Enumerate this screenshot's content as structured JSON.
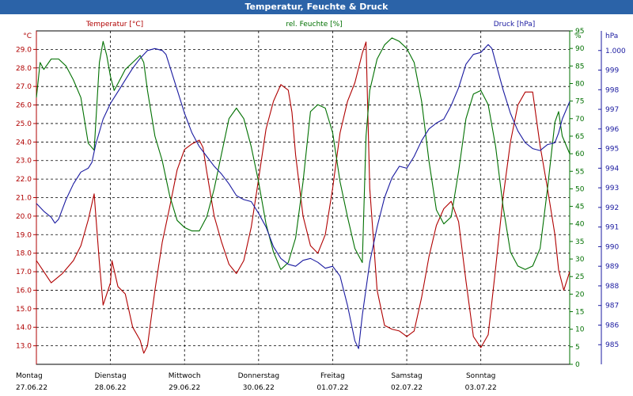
{
  "window": {
    "title": "Temperatur, Feuchte & Druck"
  },
  "chart_data": {
    "type": "line",
    "title": "Temperatur, Feuchte & Druck",
    "grid": true,
    "x_days": [
      {
        "day": "Montag",
        "date": "27.06.22"
      },
      {
        "day": "Dienstag",
        "date": "28.06.22"
      },
      {
        "day": "Mittwoch",
        "date": "29.06.22"
      },
      {
        "day": "Donnerstag",
        "date": "30.06.22"
      },
      {
        "day": "Freitag",
        "date": "01.07.22"
      },
      {
        "day": "Samstag",
        "date": "02.07.22"
      },
      {
        "day": "Sonntag",
        "date": "03.07.22"
      }
    ],
    "x_range_days": [
      0,
      7.2
    ],
    "axes": {
      "temperature": {
        "label": "Temperatur [°C]",
        "unit": "°C",
        "color": "#b00000",
        "min": 12.0,
        "max": 30.0,
        "ticks": [
          "29.0",
          "28.0",
          "27.0",
          "26.0",
          "25.0",
          "24.0",
          "23.0",
          "22.0",
          "21.0",
          "20.0",
          "19.0",
          "18.0",
          "17.0",
          "16.0",
          "15.0",
          "14.0",
          "13.0"
        ]
      },
      "humidity": {
        "label": "rel. Feuchte [%]",
        "unit": "%",
        "color": "#007000",
        "min": 0,
        "max": 95,
        "ticks": [
          "95",
          "90",
          "85",
          "80",
          "75",
          "70",
          "65",
          "60",
          "55",
          "50",
          "45",
          "40",
          "35",
          "30",
          "25",
          "20",
          "15",
          "10",
          "5",
          "0"
        ]
      },
      "pressure": {
        "label": "Druck [hPa]",
        "unit": "hPa",
        "color": "#1a1aa0",
        "min": 984.0,
        "max": 1001.0,
        "ticks": [
          "1.000",
          "999",
          "998",
          "997",
          "996",
          "995",
          "994",
          "993",
          "992",
          "991",
          "990",
          "989",
          "988",
          "987",
          "986",
          "985"
        ]
      }
    },
    "series": [
      {
        "name": "Temperatur [°C]",
        "axis": "temperature",
        "color": "#b00000",
        "points": [
          [
            0,
            17.6
          ],
          [
            0.1,
            17.0
          ],
          [
            0.2,
            16.4
          ],
          [
            0.35,
            16.9
          ],
          [
            0.5,
            17.6
          ],
          [
            0.6,
            18.4
          ],
          [
            0.7,
            19.8
          ],
          [
            0.78,
            21.2
          ],
          [
            0.85,
            17.5
          ],
          [
            0.9,
            15.2
          ],
          [
            1.0,
            16.4
          ],
          [
            1.02,
            17.6
          ],
          [
            1.1,
            16.2
          ],
          [
            1.2,
            15.8
          ],
          [
            1.3,
            14.0
          ],
          [
            1.4,
            13.3
          ],
          [
            1.45,
            12.6
          ],
          [
            1.5,
            13.0
          ],
          [
            1.6,
            16.0
          ],
          [
            1.7,
            18.6
          ],
          [
            1.8,
            20.5
          ],
          [
            1.9,
            22.5
          ],
          [
            2.0,
            23.6
          ],
          [
            2.1,
            23.9
          ],
          [
            2.2,
            24.1
          ],
          [
            2.25,
            23.7
          ],
          [
            2.3,
            22.4
          ],
          [
            2.4,
            20.0
          ],
          [
            2.5,
            18.6
          ],
          [
            2.6,
            17.4
          ],
          [
            2.7,
            16.9
          ],
          [
            2.8,
            17.6
          ],
          [
            2.9,
            19.4
          ],
          [
            3.0,
            22.0
          ],
          [
            3.1,
            24.7
          ],
          [
            3.2,
            26.2
          ],
          [
            3.3,
            27.1
          ],
          [
            3.4,
            26.8
          ],
          [
            3.45,
            25.6
          ],
          [
            3.5,
            23.3
          ],
          [
            3.6,
            20.0
          ],
          [
            3.7,
            18.4
          ],
          [
            3.8,
            18.0
          ],
          [
            3.9,
            19.0
          ],
          [
            4.0,
            21.5
          ],
          [
            4.1,
            24.5
          ],
          [
            4.2,
            26.2
          ],
          [
            4.3,
            27.2
          ],
          [
            4.4,
            28.8
          ],
          [
            4.45,
            29.4
          ],
          [
            4.5,
            21.5
          ],
          [
            4.6,
            16.0
          ],
          [
            4.7,
            14.1
          ],
          [
            4.8,
            13.9
          ],
          [
            4.9,
            13.8
          ],
          [
            5.0,
            13.5
          ],
          [
            5.1,
            13.8
          ],
          [
            5.2,
            15.6
          ],
          [
            5.3,
            17.8
          ],
          [
            5.4,
            19.5
          ],
          [
            5.5,
            20.4
          ],
          [
            5.6,
            20.8
          ],
          [
            5.7,
            19.7
          ],
          [
            5.8,
            16.5
          ],
          [
            5.9,
            13.5
          ],
          [
            6.0,
            12.9
          ],
          [
            6.1,
            13.6
          ],
          [
            6.2,
            17.2
          ],
          [
            6.3,
            21.0
          ],
          [
            6.4,
            24.0
          ],
          [
            6.5,
            26.0
          ],
          [
            6.6,
            26.7
          ],
          [
            6.7,
            26.7
          ],
          [
            6.8,
            23.8
          ],
          [
            6.9,
            21.5
          ],
          [
            7.0,
            19.0
          ],
          [
            7.05,
            17.1
          ],
          [
            7.12,
            16.0
          ],
          [
            7.2,
            17.0
          ]
        ]
      },
      {
        "name": "rel. Feuchte [%]",
        "axis": "humidity",
        "color": "#007000",
        "points": [
          [
            0,
            76
          ],
          [
            0.05,
            86
          ],
          [
            0.1,
            84
          ],
          [
            0.2,
            87
          ],
          [
            0.3,
            87
          ],
          [
            0.4,
            85
          ],
          [
            0.5,
            81
          ],
          [
            0.6,
            76
          ],
          [
            0.7,
            63
          ],
          [
            0.78,
            61
          ],
          [
            0.85,
            86
          ],
          [
            0.9,
            92
          ],
          [
            0.95,
            88
          ],
          [
            1.0,
            82
          ],
          [
            1.05,
            78
          ],
          [
            1.1,
            80
          ],
          [
            1.15,
            82
          ],
          [
            1.2,
            84
          ],
          [
            1.3,
            86
          ],
          [
            1.4,
            88
          ],
          [
            1.45,
            86
          ],
          [
            1.5,
            78
          ],
          [
            1.6,
            65
          ],
          [
            1.7,
            58
          ],
          [
            1.8,
            48
          ],
          [
            1.9,
            41
          ],
          [
            2.0,
            39
          ],
          [
            2.1,
            38
          ],
          [
            2.2,
            38
          ],
          [
            2.3,
            42
          ],
          [
            2.4,
            50
          ],
          [
            2.5,
            60
          ],
          [
            2.6,
            70
          ],
          [
            2.7,
            73
          ],
          [
            2.8,
            70
          ],
          [
            2.9,
            62
          ],
          [
            3.0,
            52
          ],
          [
            3.1,
            40
          ],
          [
            3.2,
            32
          ],
          [
            3.3,
            27
          ],
          [
            3.4,
            29
          ],
          [
            3.5,
            36
          ],
          [
            3.6,
            52
          ],
          [
            3.7,
            72
          ],
          [
            3.8,
            74
          ],
          [
            3.9,
            73
          ],
          [
            4.0,
            66
          ],
          [
            4.1,
            52
          ],
          [
            4.2,
            42
          ],
          [
            4.3,
            33
          ],
          [
            4.4,
            29
          ],
          [
            4.45,
            65
          ],
          [
            4.5,
            78
          ],
          [
            4.6,
            87
          ],
          [
            4.7,
            91
          ],
          [
            4.8,
            93
          ],
          [
            4.9,
            92
          ],
          [
            5.0,
            90
          ],
          [
            5.1,
            86
          ],
          [
            5.2,
            75
          ],
          [
            5.3,
            58
          ],
          [
            5.4,
            44
          ],
          [
            5.5,
            40
          ],
          [
            5.6,
            42
          ],
          [
            5.7,
            55
          ],
          [
            5.8,
            70
          ],
          [
            5.9,
            77
          ],
          [
            6.0,
            78
          ],
          [
            6.1,
            74
          ],
          [
            6.2,
            62
          ],
          [
            6.3,
            45
          ],
          [
            6.4,
            32
          ],
          [
            6.5,
            28
          ],
          [
            6.6,
            27
          ],
          [
            6.7,
            28
          ],
          [
            6.8,
            33
          ],
          [
            6.9,
            50
          ],
          [
            7.0,
            69
          ],
          [
            7.05,
            72
          ],
          [
            7.1,
            65
          ],
          [
            7.2,
            60
          ]
        ]
      },
      {
        "name": "Druck [hPa]",
        "axis": "pressure",
        "color": "#1a1aa0",
        "points": [
          [
            0,
            992.2
          ],
          [
            0.1,
            991.8
          ],
          [
            0.2,
            991.5
          ],
          [
            0.25,
            991.2
          ],
          [
            0.3,
            991.4
          ],
          [
            0.4,
            992.4
          ],
          [
            0.5,
            993.2
          ],
          [
            0.6,
            993.8
          ],
          [
            0.7,
            994.0
          ],
          [
            0.75,
            994.3
          ],
          [
            0.8,
            995.2
          ],
          [
            0.9,
            996.5
          ],
          [
            1.0,
            997.3
          ],
          [
            1.1,
            997.9
          ],
          [
            1.2,
            998.5
          ],
          [
            1.3,
            999.1
          ],
          [
            1.4,
            999.6
          ],
          [
            1.5,
            1000.0
          ],
          [
            1.6,
            1000.1
          ],
          [
            1.7,
            1000.0
          ],
          [
            1.75,
            999.8
          ],
          [
            1.8,
            999.2
          ],
          [
            1.9,
            998.0
          ],
          [
            2.0,
            996.8
          ],
          [
            2.1,
            995.8
          ],
          [
            2.2,
            995.1
          ],
          [
            2.3,
            994.6
          ],
          [
            2.4,
            994.1
          ],
          [
            2.5,
            993.7
          ],
          [
            2.6,
            993.2
          ],
          [
            2.7,
            992.6
          ],
          [
            2.8,
            992.4
          ],
          [
            2.9,
            992.3
          ],
          [
            3.0,
            991.7
          ],
          [
            3.1,
            991.0
          ],
          [
            3.2,
            990.0
          ],
          [
            3.3,
            989.4
          ],
          [
            3.4,
            989.1
          ],
          [
            3.5,
            989.0
          ],
          [
            3.6,
            989.3
          ],
          [
            3.7,
            989.4
          ],
          [
            3.8,
            989.2
          ],
          [
            3.9,
            988.9
          ],
          [
            4.0,
            989.0
          ],
          [
            4.1,
            988.5
          ],
          [
            4.2,
            987.0
          ],
          [
            4.3,
            985.2
          ],
          [
            4.35,
            984.8
          ],
          [
            4.4,
            986.5
          ],
          [
            4.5,
            989.2
          ],
          [
            4.6,
            991.0
          ],
          [
            4.7,
            992.5
          ],
          [
            4.8,
            993.5
          ],
          [
            4.9,
            994.1
          ],
          [
            5.0,
            994.0
          ],
          [
            5.1,
            994.6
          ],
          [
            5.2,
            995.4
          ],
          [
            5.3,
            996.0
          ],
          [
            5.4,
            996.3
          ],
          [
            5.5,
            996.5
          ],
          [
            5.6,
            997.2
          ],
          [
            5.7,
            998.1
          ],
          [
            5.8,
            999.3
          ],
          [
            5.9,
            999.8
          ],
          [
            6.0,
            999.9
          ],
          [
            6.1,
            1000.3
          ],
          [
            6.15,
            1000.1
          ],
          [
            6.2,
            999.4
          ],
          [
            6.3,
            998.0
          ],
          [
            6.4,
            996.8
          ],
          [
            6.5,
            995.9
          ],
          [
            6.6,
            995.3
          ],
          [
            6.7,
            995.0
          ],
          [
            6.8,
            994.9
          ],
          [
            6.9,
            995.2
          ],
          [
            7.0,
            995.3
          ],
          [
            7.05,
            995.8
          ],
          [
            7.1,
            996.5
          ],
          [
            7.2,
            997.4
          ]
        ]
      }
    ]
  }
}
